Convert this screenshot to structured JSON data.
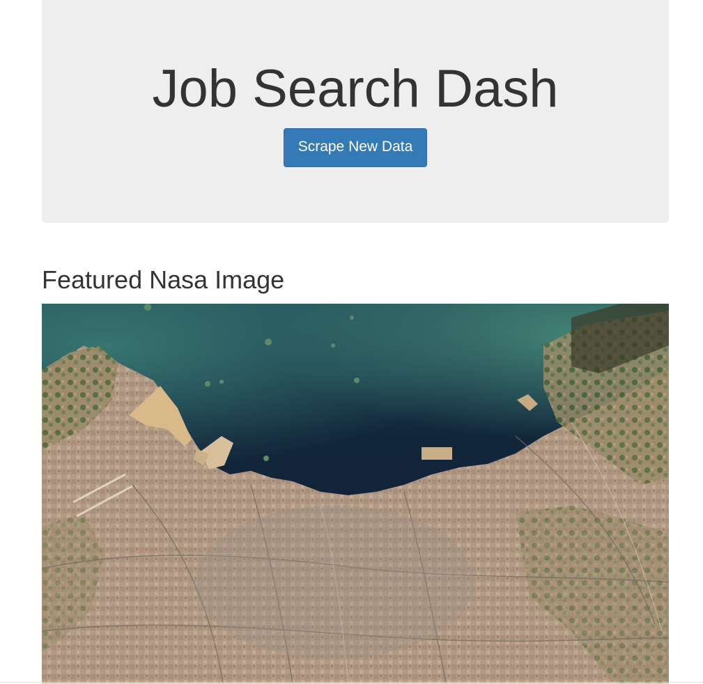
{
  "header": {
    "title": "Job Search Dash",
    "scrape_button_label": "Scrape New Data"
  },
  "featured": {
    "heading": "Featured Nasa Image",
    "image_subject": "satellite image of coastal city and bay"
  },
  "colors": {
    "jumbotron_bg": "#eeeeee",
    "button_bg": "#337ab7",
    "text": "#333333",
    "water_dark": "#0f1f33",
    "water_shallow": "#2f6b6e",
    "land_urban": "#b09680",
    "land_vegetation": "#4d6b3a"
  }
}
